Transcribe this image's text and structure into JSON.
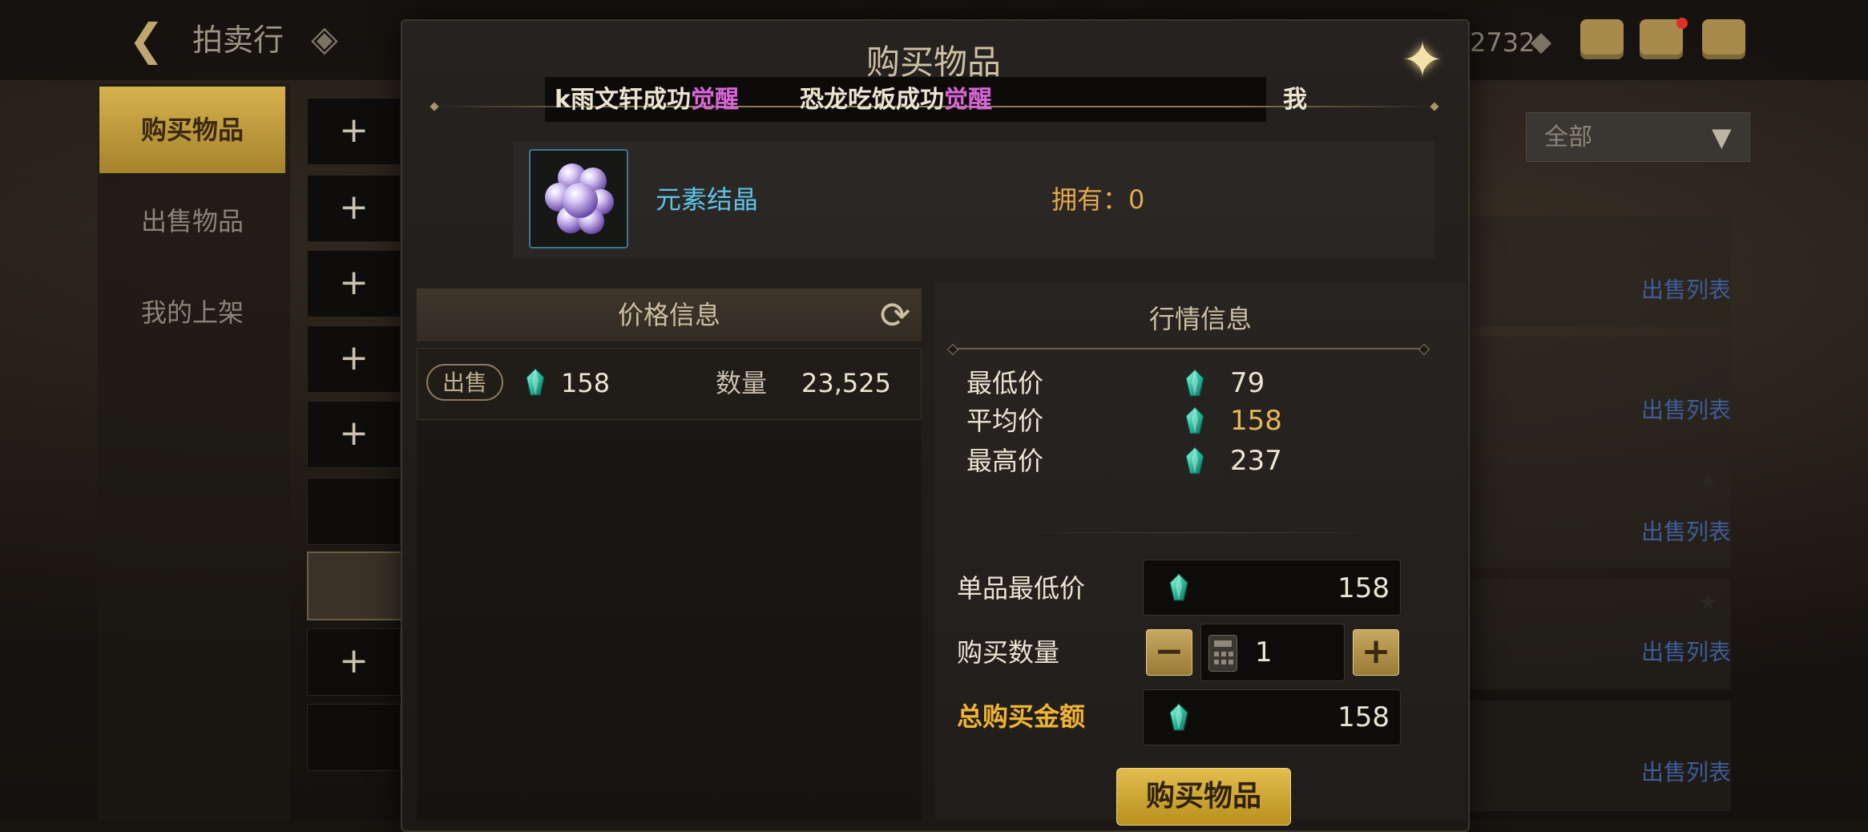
{
  "page": {
    "title": "拍卖行",
    "currency_amount": "2732"
  },
  "sidebar": {
    "items": [
      {
        "label": "购买物品",
        "active": true
      },
      {
        "label": "出售物品",
        "active": false
      },
      {
        "label": "我的上架",
        "active": false
      }
    ],
    "slot_plus": "+"
  },
  "filter": {
    "selected": "全部",
    "arrow": "▼"
  },
  "right_list": {
    "link_label": "出售列表"
  },
  "modal": {
    "title": "购买物品",
    "ticker": {
      "msg1_prefix": "k雨文轩成功",
      "msg1_highlight": "觉醒",
      "msg2_prefix": "恐龙吃饭成功",
      "msg2_highlight": "觉醒",
      "msg3_prefix": "我"
    },
    "item": {
      "name": "元素结晶",
      "owned_label": "拥有：",
      "owned_value": "0"
    },
    "price_info": {
      "title": "价格信息",
      "sell_label": "出售",
      "price": "158",
      "quantity_label": "数量",
      "quantity": "23,525"
    },
    "market_info": {
      "title": "行情信息",
      "min_label": "最低价",
      "min_value": "79",
      "avg_label": "平均价",
      "avg_value": "158",
      "max_label": "最高价",
      "max_value": "237"
    },
    "purchase": {
      "unit_price_label": "单品最低价",
      "unit_price": "158",
      "quantity_label": "购买数量",
      "quantity": "1",
      "minus": "−",
      "plus": "+",
      "total_label": "总购买金额",
      "total": "158",
      "buy_button": "购买物品"
    }
  },
  "colors": {
    "accent_gold": "#d6b24e",
    "item_name": "#5fc3e8",
    "highlight_purple": "#d866d8",
    "gem_teal": "#2fc7a3"
  }
}
